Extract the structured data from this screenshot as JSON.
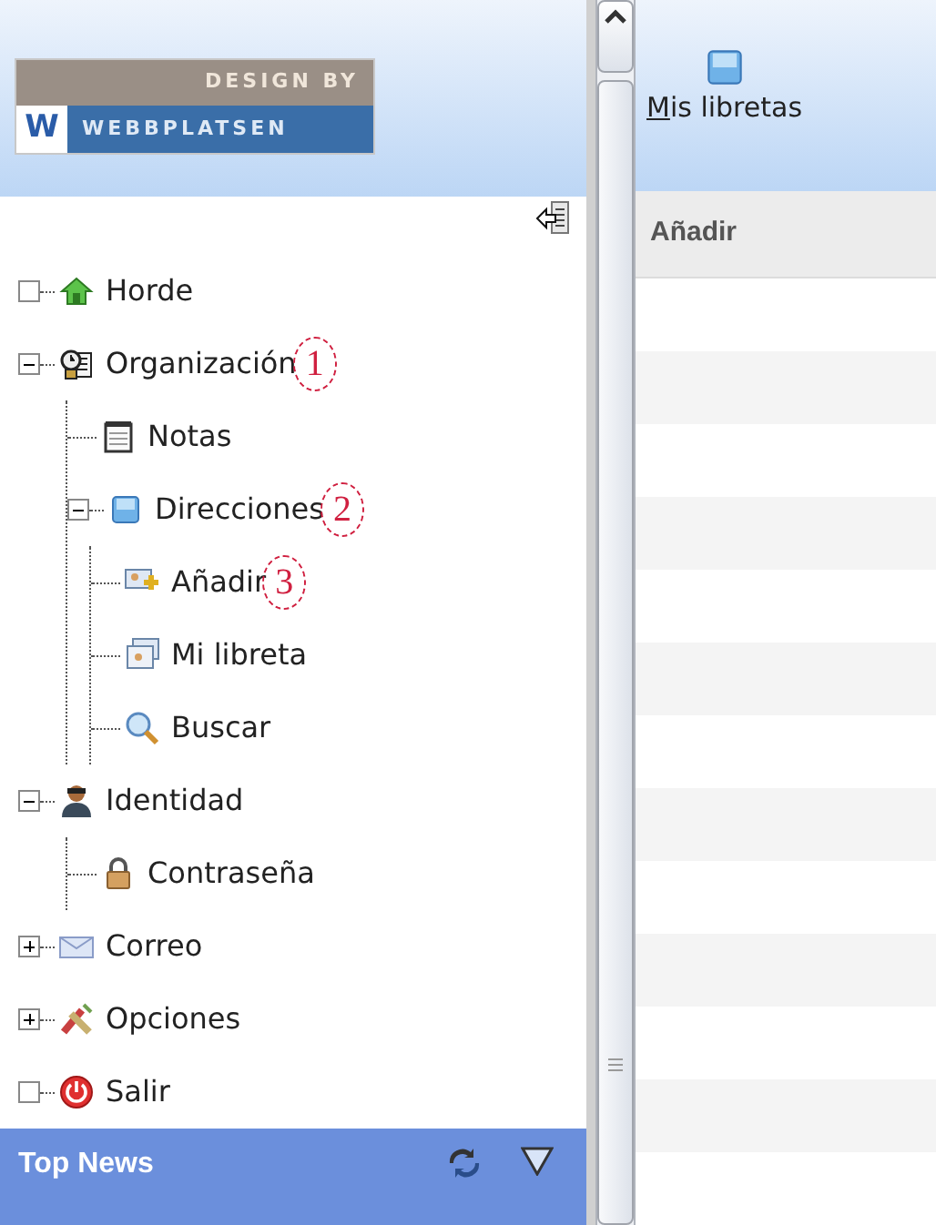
{
  "logo": {
    "top_line": "DESIGN BY",
    "mark": "W",
    "brand": "WEBBPLATSEN"
  },
  "tree": [
    {
      "label": "Horde",
      "kind": "leaf"
    },
    {
      "label": "Organización",
      "kind": "expanded",
      "annotation": "1",
      "children": [
        {
          "label": "Notas",
          "kind": "leaf"
        },
        {
          "label": "Direcciones",
          "kind": "expanded",
          "annotation": "2",
          "children": [
            {
              "label": "Añadir",
              "kind": "leaf",
              "annotation": "3"
            },
            {
              "label": "Mi libreta",
              "kind": "leaf"
            },
            {
              "label": "Buscar",
              "kind": "leaf"
            }
          ]
        }
      ]
    },
    {
      "label": "Identidad",
      "kind": "expanded",
      "children": [
        {
          "label": "Contraseña",
          "kind": "leaf"
        }
      ]
    },
    {
      "label": "Correo",
      "kind": "collapsed"
    },
    {
      "label": "Opciones",
      "kind": "collapsed"
    },
    {
      "label": "Salir",
      "kind": "leaf"
    }
  ],
  "news_bar": {
    "title": "Top News"
  },
  "toolbar": [
    {
      "label": "Mis libretas"
    }
  ],
  "table": {
    "columns": [
      "Añadir"
    ]
  }
}
